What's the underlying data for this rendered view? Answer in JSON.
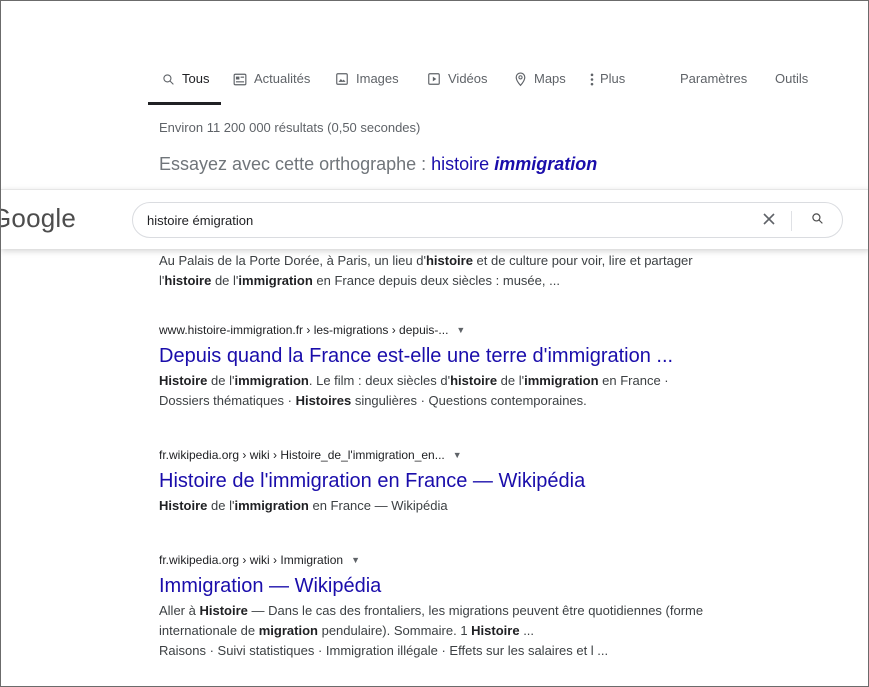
{
  "tabs": [
    {
      "label": "Tous",
      "icon": "search-icon"
    },
    {
      "label": "Actualités",
      "icon": "news-icon"
    },
    {
      "label": "Images",
      "icon": "image-icon"
    },
    {
      "label": "Vidéos",
      "icon": "video-icon"
    },
    {
      "label": "Maps",
      "icon": "map-pin-icon"
    },
    {
      "label": "Plus",
      "icon": "more-vert-icon"
    }
  ],
  "tools": {
    "settings": "Paramètres",
    "tools": "Outils"
  },
  "stats": "Environ 11 200 000 résultats (0,50 secondes)",
  "spelling": {
    "prefix": "Essayez avec cette orthographe : ",
    "word1": "histoire",
    "word2": "immigration"
  },
  "logo": "Google",
  "search": {
    "value": "histoire émigration"
  },
  "first_snippet": {
    "line1": [
      "Au Palais de la Porte Dorée, à Paris, un lieu d'",
      "histoire",
      " et de culture pour voir, lire et partager"
    ],
    "line2": [
      "l'",
      "histoire",
      " de l'",
      "immigration",
      " en France depuis deux siècles : musée, ..."
    ]
  },
  "results": [
    {
      "cite": "www.histoire-immigration.fr › les-migrations › depuis-...",
      "title": "Depuis quand la France est-elle une terre d'immigration ...",
      "lines": [
        [
          "Histoire",
          " de l'",
          "immigration",
          ". Le film : deux siècles d'",
          "histoire",
          " de l'",
          "immigration",
          " en France ·"
        ],
        [
          "Dossiers thématiques · ",
          "Histoires",
          " singulières · Questions contemporaines."
        ]
      ]
    },
    {
      "cite": "fr.wikipedia.org › wiki › Histoire_de_l'immigration_en...",
      "title": "Histoire de l'immigration en France — Wikipédia",
      "lines": [
        [
          "Histoire",
          " de l'",
          "immigration",
          " en France — Wikipédia"
        ]
      ]
    },
    {
      "cite": "fr.wikipedia.org › wiki › Immigration",
      "title": "Immigration — Wikipédia",
      "lines": [
        [
          "Aller à ",
          "Histoire",
          " — Dans le cas des frontaliers, les migrations peuvent être quotidiennes (forme"
        ],
        [
          "internationale de ",
          "migration",
          " pendulaire). Sommaire. 1 ",
          "Histoire",
          " ..."
        ],
        [
          "Raisons · Suivi statistiques · Immigration illégale · Effets sur les salaires et l ..."
        ]
      ]
    }
  ],
  "colors": {
    "link": "#1a0dab",
    "meta": "#5f6368",
    "text": "#3c4043"
  }
}
